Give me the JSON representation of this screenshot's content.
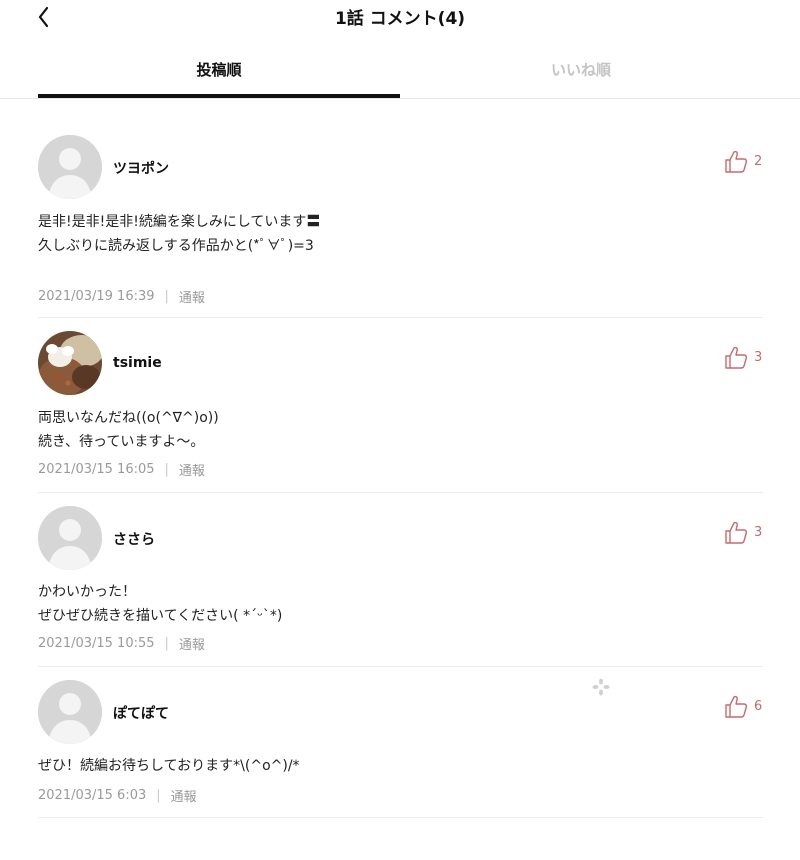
{
  "header": {
    "title": "1話 コメント(4)"
  },
  "tabs": [
    {
      "label": "投稿順",
      "active": true
    },
    {
      "label": "いいね順",
      "active": false
    }
  ],
  "colors": {
    "accent": "#111111",
    "like": "#c96a6a",
    "meta": "#9a9a9a",
    "inactive_tab": "#c4c4c4"
  },
  "icons": {
    "back": "chevron-left-icon",
    "like": "thumbs-up-icon",
    "avatar_default": "default-avatar-icon"
  },
  "comments": [
    {
      "username": "ツヨポン",
      "likes": "2",
      "body": "是非!是非!是非!続編を楽しみにしています〓\n久しぶりに読み返しする作品かと(*ﾟ∀ﾟ)=3",
      "timestamp": "2021/03/19 16:39",
      "report_label": "通報"
    },
    {
      "username": "tsimie",
      "likes": "3",
      "body": "両思いなんだね((o(^∇^)o))\n続き、待っていますよ〜。",
      "timestamp": "2021/03/15 16:05",
      "report_label": "通報"
    },
    {
      "username": "ささら",
      "likes": "3",
      "body": "かわいかった！\nぜひぜひ続きを描いてください( *´ᵕ`*)",
      "timestamp": "2021/03/15 10:55",
      "report_label": "通報"
    },
    {
      "username": "ぽてぽて",
      "likes": "6",
      "body": "ぜひ！続編お待ちしております*\\(^o^)/*",
      "timestamp": "2021/03/15 6:03",
      "report_label": "通報"
    }
  ]
}
